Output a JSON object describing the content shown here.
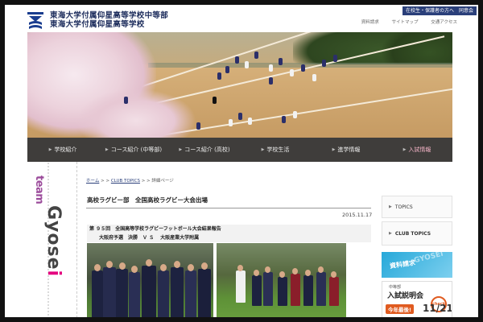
{
  "header": {
    "school_name_line1": "東海大学付属仰星高等学校中等部",
    "school_name_line2": "東海大学付属仰星高等学校",
    "util_button": "在校生・保護者の方へ",
    "agree_button": "同意会",
    "links": [
      "資料請求",
      "サイトマップ",
      "交通アクセス"
    ]
  },
  "nav": {
    "items": [
      {
        "label": "学校紹介"
      },
      {
        "label": "コース紹介 (中等部)"
      },
      {
        "label": "コース紹介 (高校)"
      },
      {
        "label": "学校生活"
      },
      {
        "label": "進学情報"
      },
      {
        "label": "入試情報"
      }
    ]
  },
  "side_banner": {
    "team": "team",
    "gyosei": "Gyosei"
  },
  "breadcrumb": {
    "home": "ホーム",
    "sep1": " > > ",
    "topics": "CLUB TOPICS",
    "sep2": " > > ",
    "current": "詳細ページ"
  },
  "article": {
    "title": "高校ラグビー部　全国高校ラグビー大会出場",
    "date": "2015.11.17",
    "report_line1": "第 ９５回　全国高等学校ラグビーフットボール大会結果報告",
    "report_line2": "大阪府予選　決勝　Ｖ Ｓ　 大阪産業大学附属"
  },
  "sidebar": {
    "items": [
      {
        "label": "TOPICS"
      },
      {
        "label": "CLUB TOPICS"
      }
    ],
    "promo_request": "資料請求",
    "promo_request_sub": "GYOSEI",
    "promo_session_small": "中等部",
    "promo_session_title": "入試説明会",
    "promo_session_tag": "今年最後!",
    "promo_session_check": "check",
    "promo_session_date": "11/21"
  },
  "colors": {
    "nav_bg": "#3f3d3b",
    "accent_pink": "#e4007f",
    "navy": "#2a3f7a"
  }
}
